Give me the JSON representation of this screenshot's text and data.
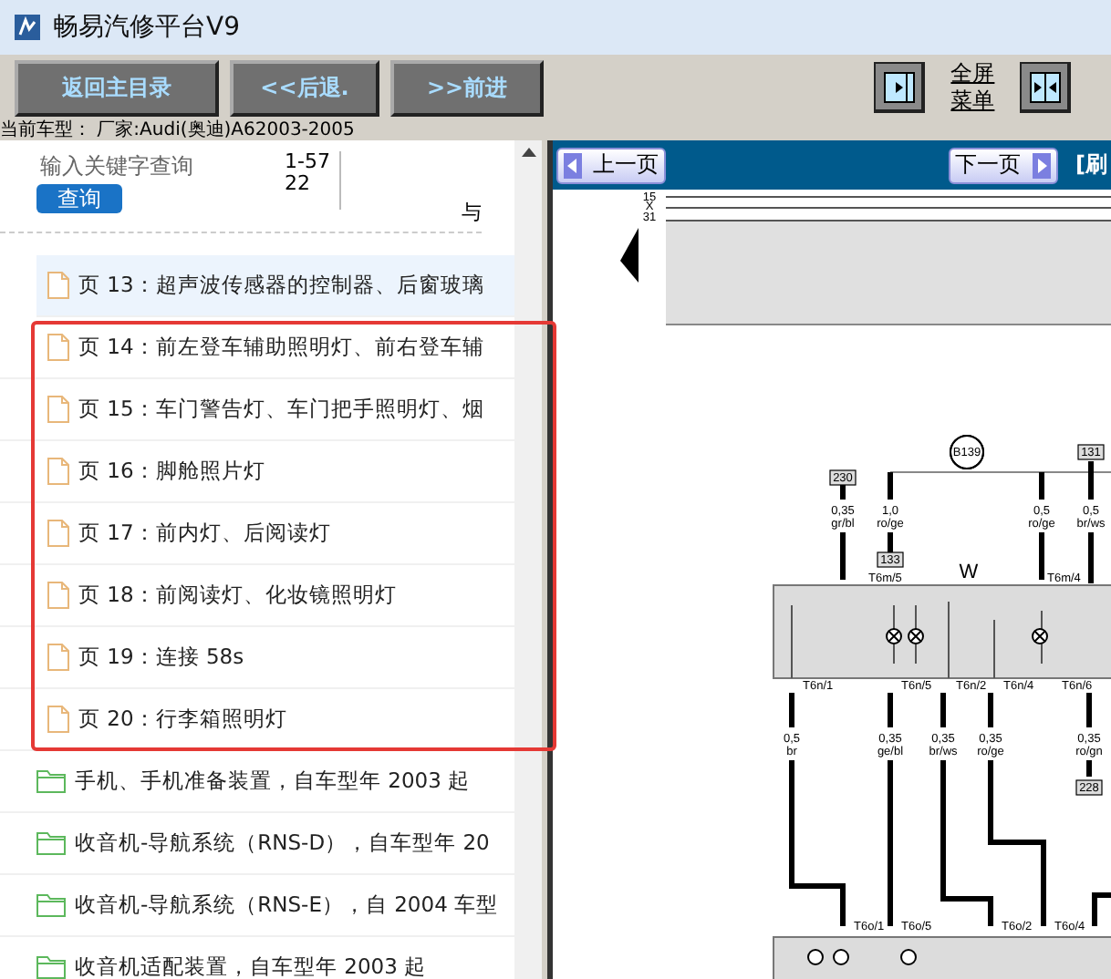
{
  "window": {
    "title": "畅易汽修平台V9"
  },
  "toolbar": {
    "buttons": [
      "返回主目录",
      "<<后退.",
      "前进"
    ],
    "forward_prefix": ">>",
    "fullscreen_link": "全屏菜单"
  },
  "vehicle_line": "当前车型： 厂家:Audi(奥迪)A62003-2005",
  "search": {
    "placeholder": "输入关键字查询",
    "button": "查询",
    "range": "1-5722",
    "column_3": "与"
  },
  "items": [
    {
      "kind": "page",
      "text": "页 13：超声波传感器的控制器、后窗玻璃",
      "selected": true
    },
    {
      "kind": "page",
      "text": "页 14：前左登车辅助照明灯、前右登车辅",
      "selected": false
    },
    {
      "kind": "page",
      "text": "页 15：车门警告灯、车门把手照明灯、烟",
      "selected": false
    },
    {
      "kind": "page",
      "text": "页 16：脚舱照片灯",
      "selected": false
    },
    {
      "kind": "page",
      "text": "页 17：前内灯、后阅读灯",
      "selected": false
    },
    {
      "kind": "page",
      "text": "页 18：前阅读灯、化妆镜照明灯",
      "selected": false
    },
    {
      "kind": "page",
      "text": "页 19：连接 58s",
      "selected": false
    },
    {
      "kind": "page",
      "text": "页 20：行李箱照明灯",
      "selected": false
    },
    {
      "kind": "folder",
      "text": "手机、手机准备装置，自车型年 2003 起",
      "selected": false
    },
    {
      "kind": "folder",
      "text": "收音机-导航系统（RNS-D），自车型年 20",
      "selected": false
    },
    {
      "kind": "folder",
      "text": "收音机-导航系统（RNS-E），自 2004 车型",
      "selected": false
    },
    {
      "kind": "folder",
      "text": "收音机适配装置，自车型年 2003 起",
      "selected": false
    }
  ],
  "viewer": {
    "prev": "上一页",
    "next": "下一页",
    "refresh": "[刷"
  },
  "diagram": {
    "labels": [
      "15",
      "X",
      "31",
      "B139",
      "230",
      "131",
      "133",
      "0,35",
      "gr/bl",
      "1,0",
      "ro/ge",
      "0,5",
      "ro/ge",
      "0,5",
      "br/ws",
      "W",
      "T6m/5",
      "T6m/4",
      "T6n/1",
      "T6n/5",
      "T6n/2",
      "T6n/4",
      "T6n/6",
      "0,5",
      "br",
      "0,35",
      "ge/bl",
      "0,35",
      "br/ws",
      "0,35",
      "ro/ge",
      "0,35",
      "ro/gn",
      "228",
      "T6o/1",
      "T6o/5",
      "T6o/2",
      "T6o/4"
    ]
  }
}
